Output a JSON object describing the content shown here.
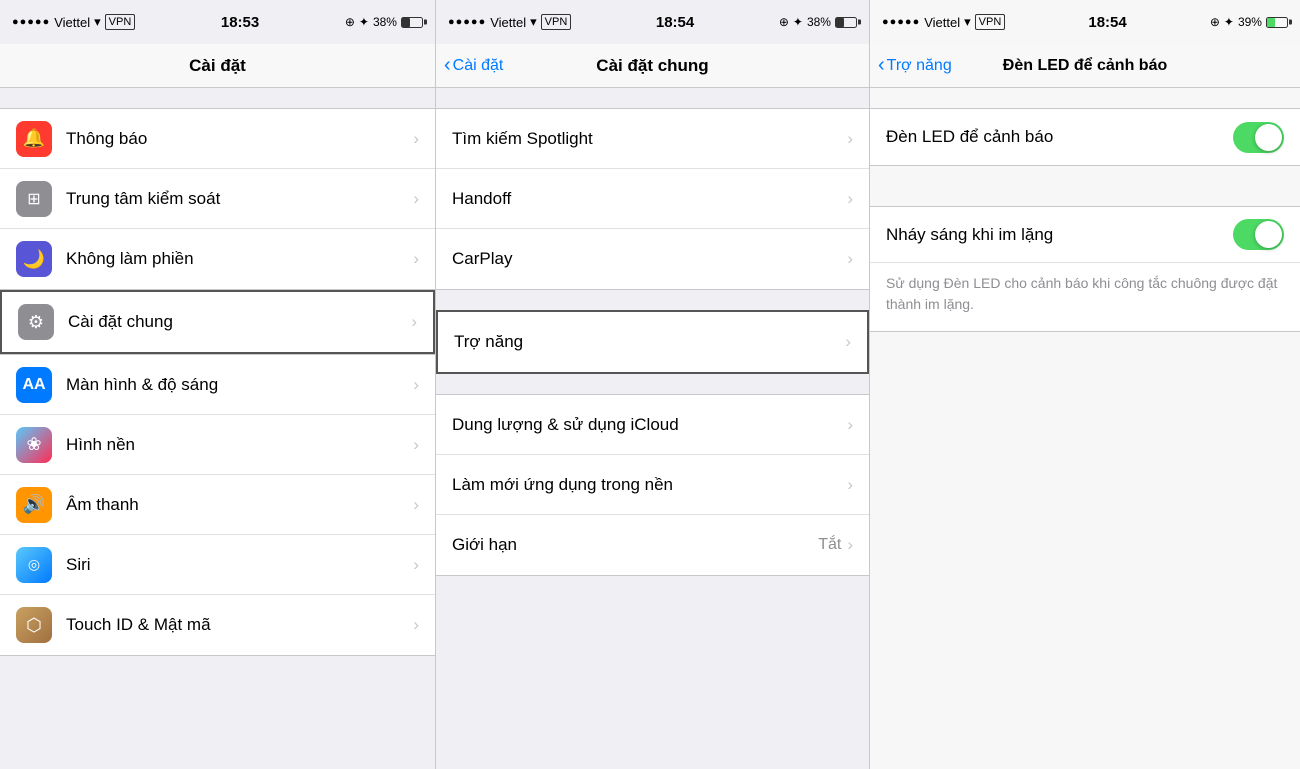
{
  "panel1": {
    "statusBar": {
      "carrier": "Viettel",
      "time": "18:53",
      "battery": "38%"
    },
    "navTitle": "Cài đặt",
    "items": [
      {
        "label": "Thông báo",
        "iconBg": "icon-red",
        "iconChar": "🔔"
      },
      {
        "label": "Trung tâm kiểm soát",
        "iconBg": "icon-gray",
        "iconChar": "⊞"
      },
      {
        "label": "Không làm phiền",
        "iconBg": "icon-purple",
        "iconChar": "🌙"
      },
      {
        "label": "Cài đặt chung",
        "iconBg": "icon-gear",
        "iconChar": "⚙️",
        "selected": true
      },
      {
        "label": "Màn hình & độ sáng",
        "iconBg": "icon-blue",
        "iconChar": "AA"
      },
      {
        "label": "Hình nền",
        "iconBg": "icon-pink",
        "iconChar": "❀"
      },
      {
        "label": "Âm thanh",
        "iconBg": "icon-orange",
        "iconChar": "🔊"
      },
      {
        "label": "Siri",
        "iconBg": "icon-teal",
        "iconChar": "◎"
      },
      {
        "label": "Touch ID & Mật mã",
        "iconBg": "icon-gold",
        "iconChar": "⬡"
      }
    ]
  },
  "panel2": {
    "statusBar": {
      "carrier": "Viettel",
      "time": "18:54",
      "battery": "38%"
    },
    "navBack": "Cài đặt",
    "navTitle": "Cài đặt chung",
    "items": [
      {
        "label": "Tìm kiếm Spotlight"
      },
      {
        "label": "Handoff"
      },
      {
        "label": "CarPlay"
      },
      {
        "label": "Trợ năng",
        "selected": true
      },
      {
        "label": "Dung lượng & sử dụng iCloud"
      },
      {
        "label": "Làm mới ứng dụng trong nền"
      },
      {
        "label": "Giới hạn",
        "value": "Tắt"
      }
    ]
  },
  "panel3": {
    "statusBar": {
      "carrier": "Viettel",
      "time": "18:54",
      "battery": "39%"
    },
    "navBack": "Trợ năng",
    "navTitle": "Đèn LED để cảnh báo",
    "settings": [
      {
        "label": "Đèn LED để cảnh báo",
        "toggleOn": true
      },
      {
        "label": "Nháy sáng khi im lặng",
        "toggleOn": true
      }
    ],
    "description": "Sử dụng Đèn LED cho cảnh báo khi công tắc chuông được đặt thành im lặng."
  }
}
